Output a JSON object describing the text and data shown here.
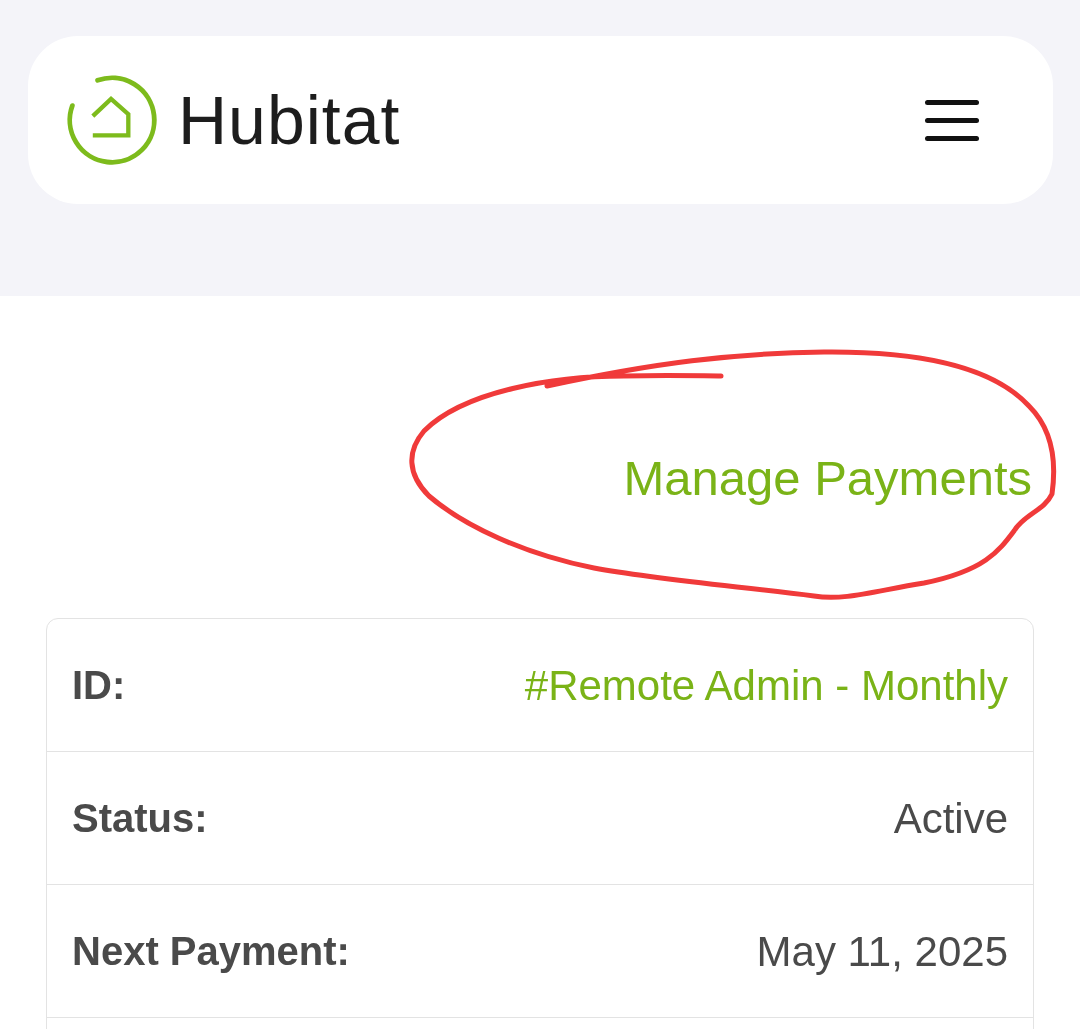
{
  "header": {
    "logo_text": "Hubitat"
  },
  "manage_payments": {
    "label": "Manage Payments"
  },
  "subscription": {
    "rows": [
      {
        "label": "ID:",
        "value": "#Remote Admin - Monthly",
        "kind": "link"
      },
      {
        "label": "Status:",
        "value": "Active",
        "kind": "text"
      },
      {
        "label": "Next Payment:",
        "value": "May 11, 2025",
        "kind": "text"
      }
    ]
  }
}
